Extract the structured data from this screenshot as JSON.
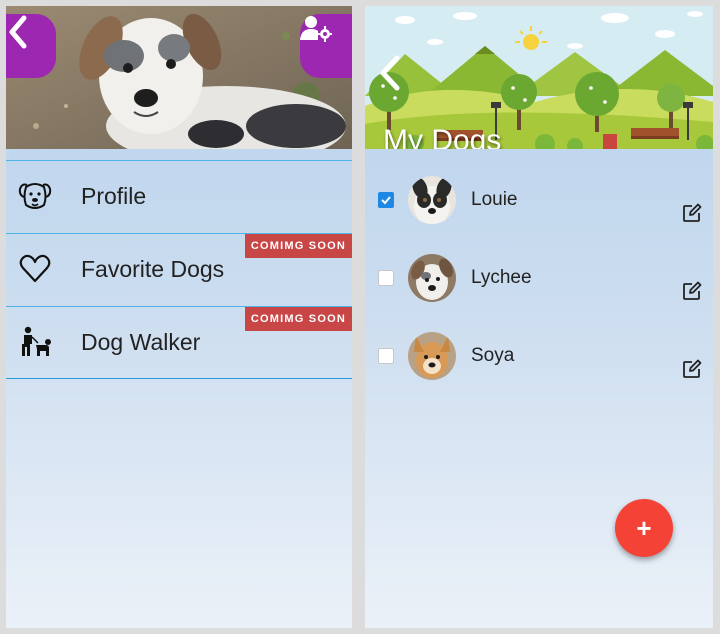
{
  "left_panel": {
    "menu": [
      {
        "label": "Profile",
        "icon": "dog-face-icon",
        "badge": ""
      },
      {
        "label": "Favorite Dogs",
        "icon": "heart-icon",
        "badge": "COMIMG SOON"
      },
      {
        "label": "Dog Walker",
        "icon": "dog-walker-icon",
        "badge": "COMIMG SOON"
      }
    ],
    "accent": "#9c27b0"
  },
  "right_panel": {
    "title": "My Dogs",
    "dogs": [
      {
        "name": "Louie",
        "checked": true
      },
      {
        "name": "Lychee",
        "checked": false
      },
      {
        "name": "Soya",
        "checked": false
      }
    ],
    "add_label": "+",
    "fab_color": "#f44336",
    "checkbox_color": "#1e88e5"
  }
}
